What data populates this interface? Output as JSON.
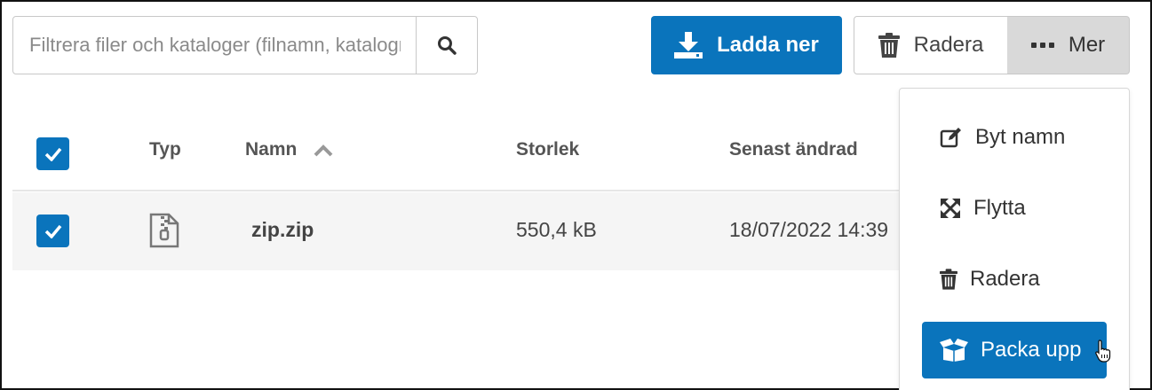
{
  "search": {
    "placeholder": "Filtrera filer och kataloger (filnamn, katalognamn)"
  },
  "toolbar": {
    "download_label": "Ladda ner",
    "delete_label": "Radera",
    "more_label": "Mer"
  },
  "table": {
    "columns": {
      "type": "Typ",
      "name": "Namn",
      "size": "Storlek",
      "modified": "Senast ändrad"
    },
    "rows": [
      {
        "name": "zip.zip",
        "size": "550,4 kB",
        "modified": "18/07/2022 14:39"
      }
    ]
  },
  "menu": {
    "items": [
      {
        "label": "Byt namn",
        "icon": "edit-icon"
      },
      {
        "label": "Flytta",
        "icon": "move-icon"
      },
      {
        "label": "Radera",
        "icon": "trash-icon"
      },
      {
        "label": "Packa upp",
        "icon": "box-open-icon"
      }
    ]
  },
  "colors": {
    "accent": "#0a74bc",
    "row_bg": "#f5f5f5",
    "more_bg": "#d9d9d9"
  }
}
